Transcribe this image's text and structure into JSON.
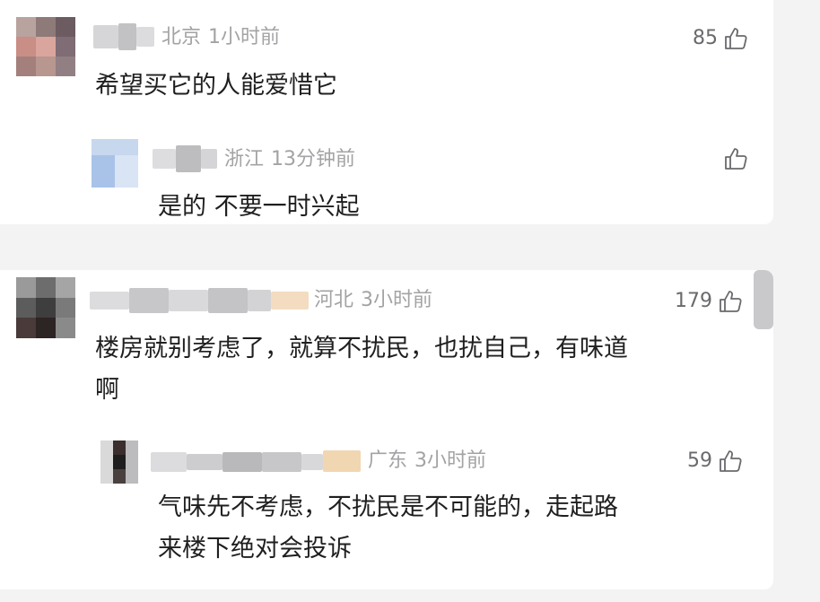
{
  "comments": [
    {
      "location": "北京",
      "time": "1小时前",
      "likes": "85",
      "text": "希望买它的人能爱惜它",
      "reply": {
        "location": "浙江",
        "time": "13分钟前",
        "likes": "",
        "text": "是的 不要一时兴起"
      }
    },
    {
      "location": "河北",
      "time": "3小时前",
      "likes": "179",
      "text_line1": "楼房就别考虑了，就算不扰民，也扰自己，有味道",
      "text_line2": "啊",
      "reply": {
        "location": "广东",
        "time": "3小时前",
        "likes": "59",
        "text_line1": "气味先不考虑，不扰民是不可能的，走起路",
        "text_line2": "来楼下绝对会投诉"
      }
    }
  ],
  "icons": {
    "like": "thumbs-up-icon"
  },
  "colors": {
    "meta": "#a3a3a6",
    "text": "#1f1f1f",
    "background": "#f3f3f4"
  }
}
